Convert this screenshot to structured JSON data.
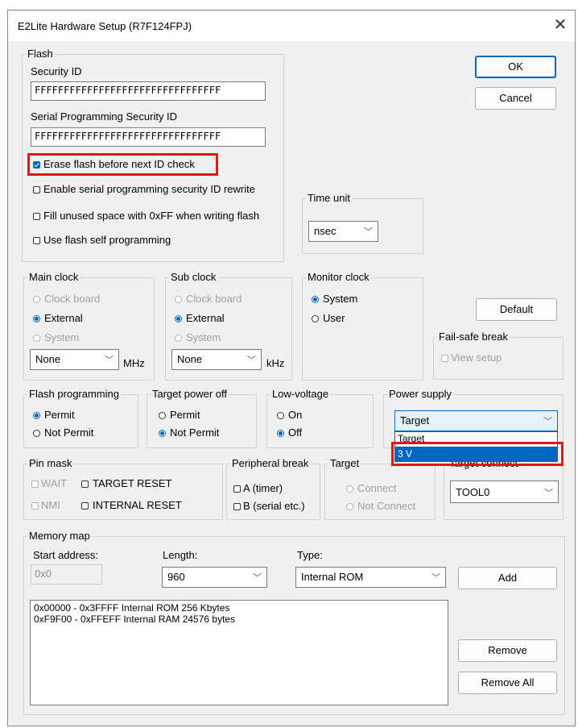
{
  "window": {
    "title": "E2Lite Hardware Setup (R7F124FPJ)",
    "close_glyph": "✕"
  },
  "flash": {
    "group_label": "Flash",
    "security_id_label": "Security ID",
    "security_id_value": "FFFFFFFFFFFFFFFFFFFFFFFFFFFFFFFF",
    "serial_id_label": "Serial Programming Security ID",
    "serial_id_value": "FFFFFFFFFFFFFFFFFFFFFFFFFFFFFFFF",
    "erase_label": "Erase flash before next ID check",
    "enable_serial_label": "Enable serial programming security ID rewrite",
    "fill_unused_label": "Fill unused space with 0xFF when writing flash",
    "self_prog_label": "Use flash self programming"
  },
  "time_unit": {
    "group_label": "Time unit",
    "value": "nsec"
  },
  "buttons": {
    "ok": "OK",
    "cancel": "Cancel",
    "default": "Default",
    "add": "Add",
    "remove": "Remove",
    "remove_all": "Remove All"
  },
  "main_clock": {
    "group_label": "Main clock",
    "clock_board": "Clock board",
    "external": "External",
    "system": "System",
    "select": "None",
    "unit": "MHz"
  },
  "sub_clock": {
    "group_label": "Sub clock",
    "clock_board": "Clock board",
    "external": "External",
    "system": "System",
    "select": "None",
    "unit": "kHz"
  },
  "monitor_clock": {
    "group_label": "Monitor clock",
    "system": "System",
    "user": "User"
  },
  "fail_safe": {
    "group_label": "Fail-safe break",
    "view_setup": "View setup"
  },
  "flash_programming": {
    "group_label": "Flash programming",
    "permit": "Permit",
    "not_permit": "Not Permit"
  },
  "target_power_off": {
    "group_label": "Target power off",
    "permit": "Permit",
    "not_permit": "Not Permit"
  },
  "low_voltage": {
    "group_label": "Low-voltage",
    "on": "On",
    "off": "Off"
  },
  "power_supply": {
    "group_label": "Power supply",
    "value": "Target",
    "options": [
      "Target",
      "3 V"
    ]
  },
  "pin_mask": {
    "group_label": "Pin mask",
    "wait": "WAIT",
    "target_reset": "TARGET RESET",
    "nmi": "NMI",
    "internal_reset": "INTERNAL RESET"
  },
  "peripheral_break": {
    "group_label": "Peripheral break",
    "a": "A (timer)",
    "b": "B (serial etc.)"
  },
  "target": {
    "group_label": "Target",
    "connect": "Connect",
    "not_connect": "Not Connect"
  },
  "target_connect": {
    "group_label": "Target connect",
    "value": "TOOL0"
  },
  "memory_map": {
    "group_label": "Memory map",
    "start_label": "Start address:",
    "start_value": "0x0",
    "length_label": "Length:",
    "length_value": "960",
    "type_label": "Type:",
    "type_value": "Internal ROM",
    "entries": [
      "0x00000 - 0x3FFFF Internal ROM  256  Kbytes",
      "0xF9F00 - 0xFFEFF Internal RAM  24576  bytes"
    ]
  },
  "chevron": "﹀",
  "colors": {
    "highlight": "#e3141b",
    "accent": "#0067c0",
    "background": "#f0f0f0"
  }
}
